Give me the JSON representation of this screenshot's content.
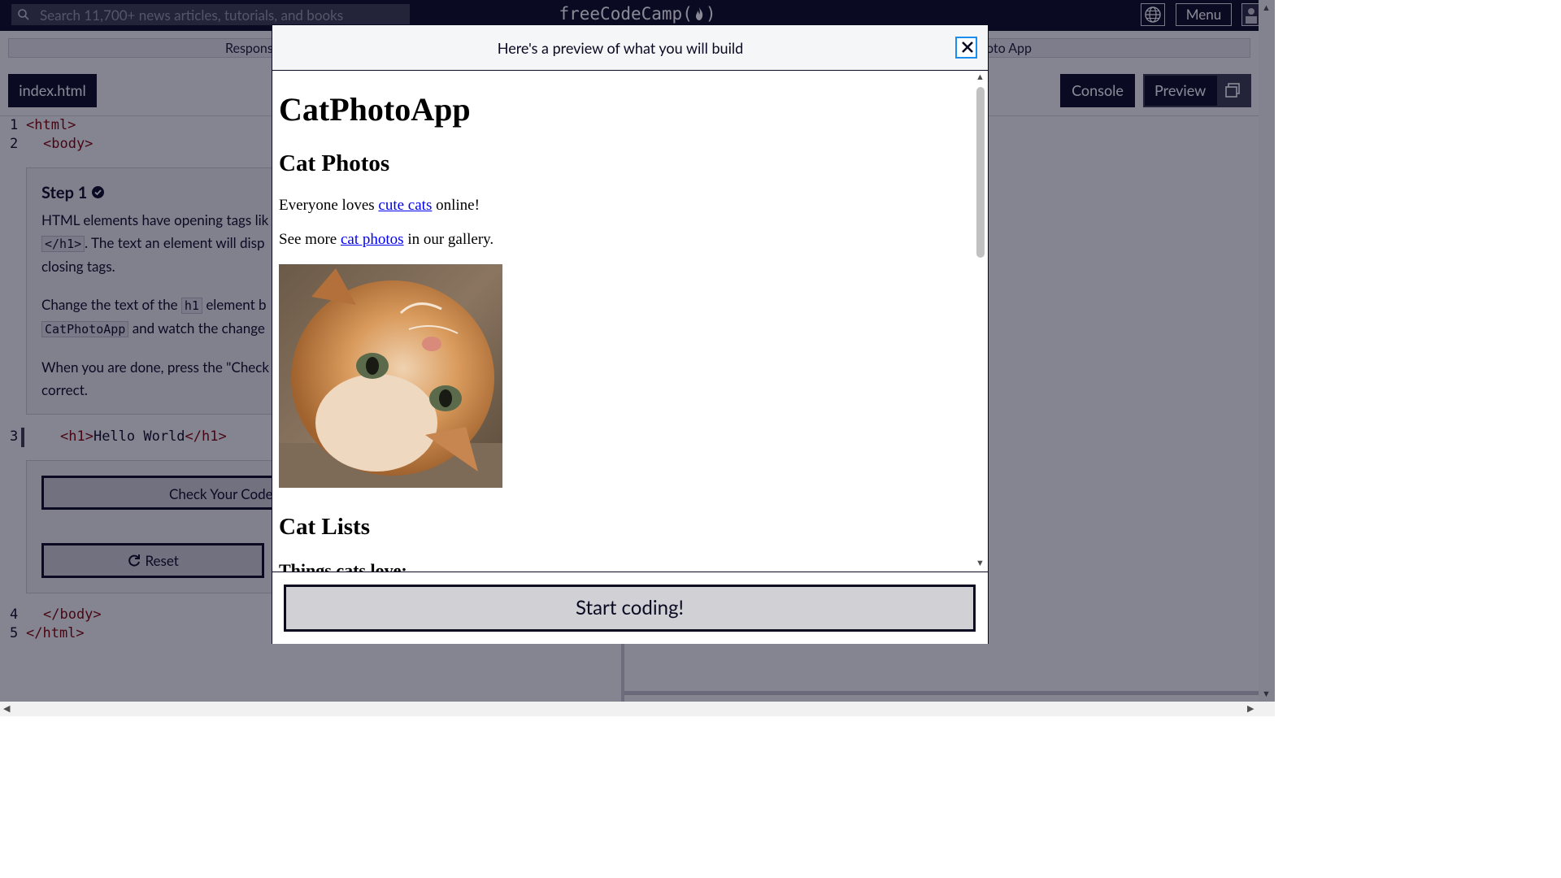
{
  "nav": {
    "search_placeholder": "Search 11,700+ news articles, tutorials, and books",
    "logo": "freeCodeCamp(🔥)",
    "logo_text": "freeCodeCamp(",
    "logo_close": ")",
    "menu_label": "Menu"
  },
  "breadcrumb": {
    "left": "Respons",
    "right": "oto App"
  },
  "editor": {
    "file_tab": "index.html",
    "console_label": "Console",
    "preview_label": "Preview",
    "lines": [
      {
        "num": "1",
        "code": "<html>"
      },
      {
        "num": "2",
        "code": "<body>"
      },
      {
        "num": "3",
        "code": "<h1>Hello World</h1>"
      },
      {
        "num": "4",
        "code": "</body>"
      },
      {
        "num": "5",
        "code": "</html>"
      }
    ],
    "line3_open": "<h1>",
    "line3_text": "Hello World",
    "line3_close": "</h1>"
  },
  "step": {
    "title": "Step 1",
    "p1_a": "HTML elements have opening tags lik",
    "p1_code": "</h1>",
    "p1_b": ". The text an element will disp",
    "p1_c": "closing tags.",
    "p2_a": "Change the text of the ",
    "p2_code1": "h1",
    "p2_b": " element b",
    "p2_code2": "CatPhotoApp",
    "p2_c": " and watch the change",
    "p3_a": "When you are done, press the \"Check",
    "p3_b": "correct.",
    "check_label": "Check Your Code",
    "reset_label": "Reset"
  },
  "modal": {
    "title": "Here's a preview of what you will build",
    "close_symbol": "×",
    "preview": {
      "h1": "CatPhotoApp",
      "h2_photos": "Cat Photos",
      "p1_before": "Everyone loves ",
      "p1_link": "cute cats",
      "p1_after": " online!",
      "p2_before": "See more ",
      "p2_link": "cat photos",
      "p2_after": " in our gallery.",
      "img_alt": "cat",
      "h2_lists": "Cat Lists",
      "h3_things": "Things cats love:"
    },
    "start_label": "Start coding!"
  },
  "colors": {
    "primary_dark": "#0a0a23",
    "focus_ring": "#198eee",
    "link": "#0000ee"
  }
}
